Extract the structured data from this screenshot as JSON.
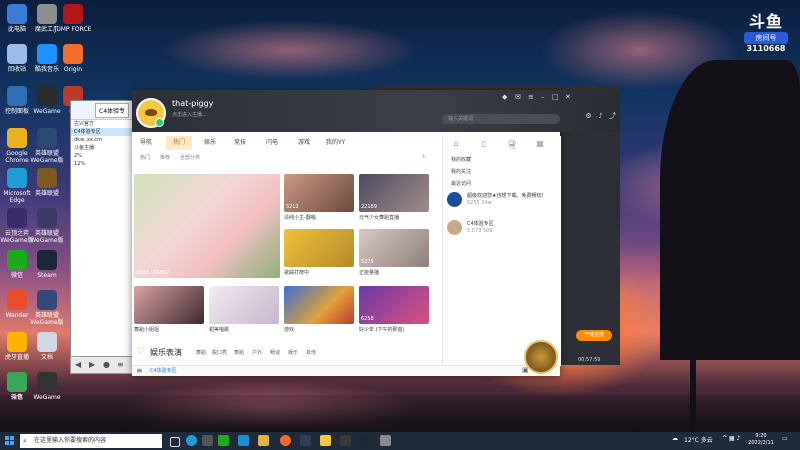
{
  "desktop": {
    "icons": [
      {
        "label": "此电脑",
        "name": "this-pc-icon",
        "color": "#3a7bd5"
      },
      {
        "label": "魔武工厂",
        "name": "factory-icon",
        "color": "#8e8e8e"
      },
      {
        "label": "JUMP FORCE",
        "name": "jump-force-icon",
        "color": "#b01818"
      },
      {
        "label": "回收站",
        "name": "recycle-bin-icon",
        "color": "#9bbde8"
      },
      {
        "label": "酷我音乐",
        "name": "kuwo-music-icon",
        "color": "#1e90ff"
      },
      {
        "label": "Origin",
        "name": "origin-icon",
        "color": "#f56c2d"
      },
      {
        "label": "控制面板",
        "name": "control-panel-icon",
        "color": "#2f6db5"
      },
      {
        "label": "WeGame",
        "name": "wegame-icon",
        "color": "#2a2a2a"
      },
      {
        "label": "Ea",
        "name": "ea-icon",
        "color": "#c0392b"
      },
      {
        "label": "Google Chrome",
        "name": "chrome-icon",
        "color": "#e8b31e"
      },
      {
        "label": "英雄联盟 WeGame版",
        "name": "lol-icon",
        "color": "#2b4a72"
      },
      {
        "label": "Microsoft Edge",
        "name": "edge-icon",
        "color": "#1f9cd4"
      },
      {
        "label": "英雄联盟",
        "name": "lol2-icon",
        "color": "#7c5a22"
      },
      {
        "label": "云顶之弈 WeGame版",
        "name": "tft-icon",
        "color": "#3a2c6a"
      },
      {
        "label": "英雄联盟 WeGame版",
        "name": "lol3-icon",
        "color": "#3b3b66"
      },
      {
        "label": "微信",
        "name": "wechat-icon",
        "color": "#1aad19"
      },
      {
        "label": "Steam",
        "name": "steam-icon",
        "color": "#1b2838"
      },
      {
        "label": "Wander",
        "name": "wander-icon",
        "color": "#e94d2c"
      },
      {
        "label": "英雄联盟 WeGame版",
        "name": "lol4-icon",
        "color": "#34497a"
      },
      {
        "label": "虎牙直播",
        "name": "huya-icon",
        "color": "#ffb300"
      },
      {
        "label": "文档",
        "name": "doc-icon",
        "color": "#cfd8e3"
      },
      {
        "label": "斗鱼",
        "name": "douyu-icon",
        "color": "#ff7b00"
      },
      {
        "label": "WeGame",
        "name": "wegame2-icon",
        "color": "#333"
      },
      {
        "label": "微信",
        "name": "wechat2-icon",
        "color": "#3aa757"
      }
    ],
    "watermark": {
      "logo": "斗鱼",
      "badge": "房间号",
      "room": "3110668"
    }
  },
  "leftwin": {
    "tab": "C4体验专",
    "rows": [
      "古兴官方",
      "C4体验专区",
      "dkw..xx.cm",
      "斗鱼主播",
      "2%",
      "12%"
    ]
  },
  "app": {
    "user": {
      "name": "that-piggy",
      "subtitle": "点击进入主播..."
    },
    "search_placeholder": "输入关键词",
    "nav": [
      "导航",
      "热门",
      "娱乐",
      "竞技",
      "闪电",
      "游戏",
      "我的YY"
    ],
    "subnav": [
      "热门",
      "推荐",
      "全部分类"
    ],
    "thumbs": [
      {
        "count": "2003",
        "id": "45987",
        "caption": ""
      },
      {
        "count": "5212",
        "caption": "清纯小主-翻唱"
      },
      {
        "count": "22189",
        "caption": "元气少女舞蹈直播"
      },
      {
        "count": "",
        "caption": "歌曲打榜中"
      },
      {
        "count": "5275",
        "caption": "正能量播"
      },
      {
        "count": "",
        "caption": "舞蹈小姐姐"
      },
      {
        "count": "",
        "caption": "甜美唱跳"
      },
      {
        "count": "",
        "caption": "游戏"
      },
      {
        "count": "6258",
        "caption": "好少年 (下午的那首)"
      }
    ],
    "section": {
      "title": "娱乐表演",
      "tags": [
        "舞蹈",
        "脱口秀",
        "舞蹈",
        "户外",
        "畅谈",
        "娱乐",
        "其他"
      ]
    },
    "right": {
      "links": [
        "我的收藏",
        "我的关注",
        "最近访问"
      ],
      "messages": [
        {
          "title": "超级欢迎您★也想下载。免费畅玩!",
          "sub": "5255.59w"
        },
        {
          "title": "C4体验专区",
          "sub": "5.073 109"
        }
      ]
    },
    "footer": {
      "label": "C4体验专区"
    },
    "live_button": "开播直播",
    "dark_info": "00:57:59"
  },
  "taskbar": {
    "search": "在这里输入你要搜索的内容",
    "weather": "12°C 多云",
    "time": "9:20",
    "date": "2022/2/11"
  }
}
